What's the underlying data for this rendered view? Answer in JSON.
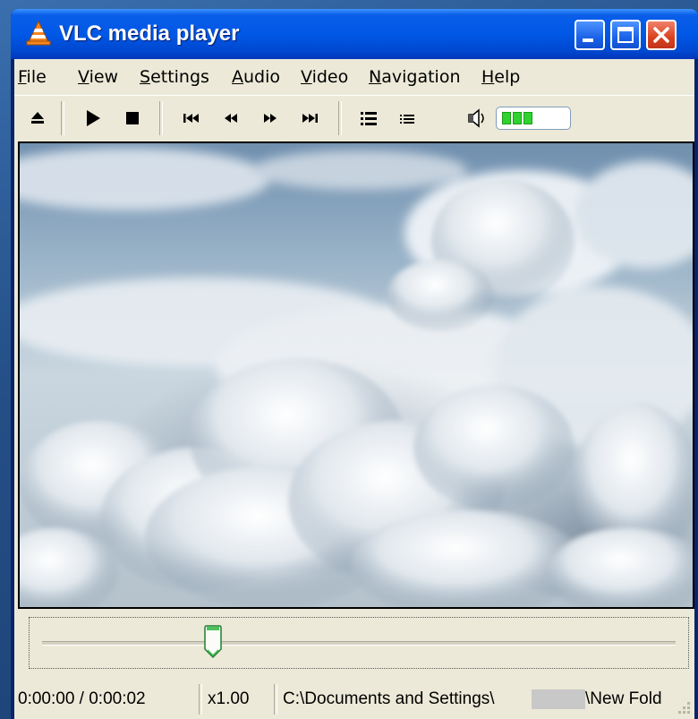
{
  "window": {
    "title": "VLC media player",
    "icon": "vlc-cone-icon",
    "controls": [
      "minimize-icon",
      "maximize-icon",
      "close-icon"
    ]
  },
  "menu": {
    "file": {
      "accel": "F",
      "rest": "ile"
    },
    "view": {
      "accel": "V",
      "rest": "iew"
    },
    "settings": {
      "accel": "S",
      "rest": "ettings"
    },
    "audio": {
      "accel": "A",
      "rest": "udio"
    },
    "video": {
      "accel": "V",
      "rest": "ideo"
    },
    "navigation": {
      "accel": "N",
      "rest": "avigation"
    },
    "help": {
      "accel": "H",
      "rest": "elp"
    }
  },
  "toolbar": {
    "buttons": [
      "eject-icon",
      "play-icon",
      "stop-icon",
      "previous-icon",
      "rewind-icon",
      "fast-forward-icon",
      "next-icon",
      "playlist-icon",
      "extended-settings-icon"
    ],
    "volume_icon": "speaker-icon",
    "volume_level": 0.6,
    "volume_color": "#2fd22f"
  },
  "video": {
    "content": "sky-above-clouds"
  },
  "seek": {
    "position": 0.27
  },
  "status": {
    "time": "0:00:00 / 0:00:02",
    "speed": "x1.00",
    "path_start": "C:\\Documents and Settings\\",
    "path_end": "\\New Fold"
  },
  "colors": {
    "titlebar": "#0058e6",
    "face": "#ece9d8",
    "close": "#d9421e"
  }
}
